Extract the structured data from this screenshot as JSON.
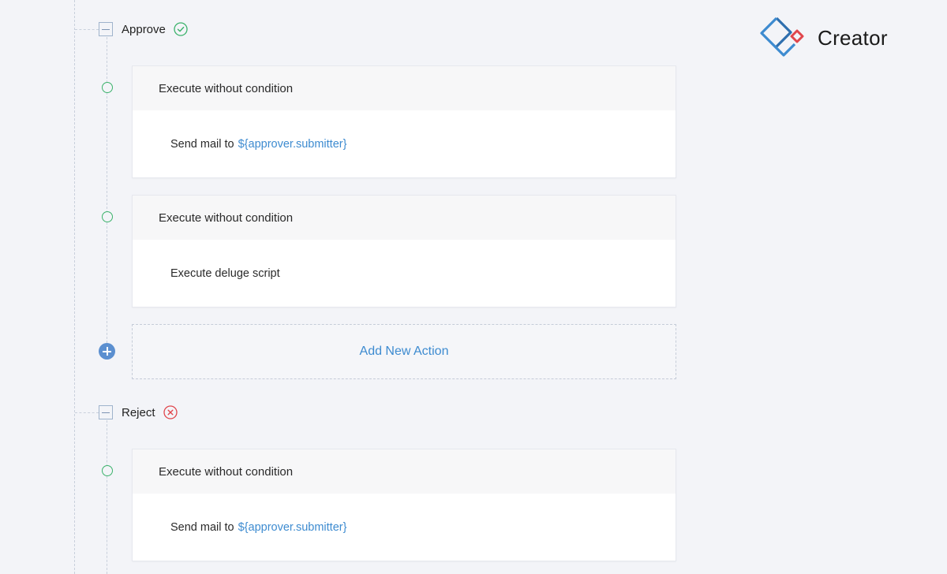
{
  "brand": {
    "name": "Creator",
    "logo_icon": "creator-diamond-logo"
  },
  "sections": [
    {
      "title": "Approve",
      "status_icon": "check-circle-icon",
      "status_color": "#3bb26b",
      "actions": [
        {
          "condition": "Execute without condition",
          "action_text": "Send mail to",
          "target": "${approver.submitter}"
        },
        {
          "condition": "Execute without condition",
          "action_text": "Execute deluge script",
          "target": ""
        }
      ],
      "add_label": "Add New Action"
    },
    {
      "title": "Reject",
      "status_icon": "x-circle-icon",
      "status_color": "#e0464c",
      "actions": [
        {
          "condition": "Execute without condition",
          "action_text": "Send mail to",
          "target": "${approver.submitter}"
        }
      ]
    }
  ],
  "colors": {
    "link": "#3d8bd0",
    "node_green": "#3bb26b",
    "add_blue": "#5b8fd0"
  }
}
